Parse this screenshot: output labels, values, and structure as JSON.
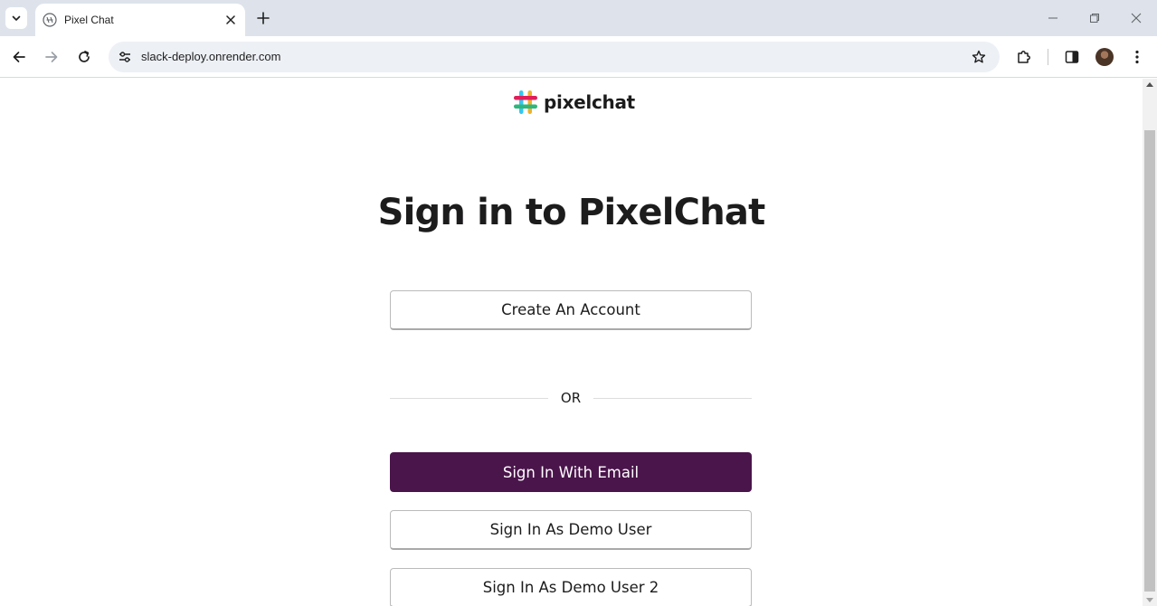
{
  "browser": {
    "tab_title": "Pixel Chat",
    "url": "slack-deploy.onrender.com"
  },
  "page": {
    "logo_text": "pixelchat",
    "heading": "Sign in to PixelChat",
    "create_account_label": "Create An Account",
    "divider_text": "OR",
    "sign_in_email_label": "Sign In With Email",
    "demo_user_label": "Sign In As Demo User",
    "demo_user_2_label": "Sign In As Demo User 2"
  },
  "colors": {
    "primary": "#4a154b",
    "logo_red": "#e01e5a",
    "logo_blue": "#36c5f0",
    "logo_green": "#2eb67d",
    "logo_yellow": "#ecb22e"
  },
  "icons": {
    "tab_favicon": "pixel-chat-favicon-icon",
    "tab_close": "close-icon",
    "new_tab": "plus-icon",
    "back": "arrow-left-icon",
    "forward": "arrow-right-icon",
    "reload": "reload-icon",
    "site_info": "tune-icon",
    "bookmark": "star-icon",
    "extensions": "puzzle-icon",
    "side_panel": "side-panel-icon",
    "menu": "kebab-menu-icon"
  }
}
